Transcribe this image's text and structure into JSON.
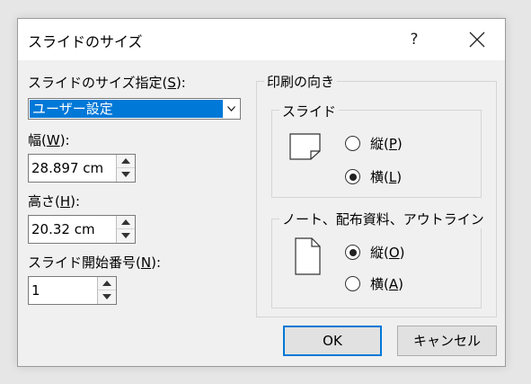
{
  "window": {
    "title": "スライドのサイズ",
    "help": "?"
  },
  "slide_size": {
    "label_prefix": "スライドのサイズ指定(",
    "label_key": "S",
    "label_suffix": "):",
    "selected": "ユーザー設定"
  },
  "width": {
    "label_prefix": "幅(",
    "label_key": "W",
    "label_suffix": "):",
    "value": "28.897 cm"
  },
  "height": {
    "label_prefix": "高さ(",
    "label_key": "H",
    "label_suffix": "):",
    "value": "20.32 cm"
  },
  "start_number": {
    "label_prefix": "スライド開始番号(",
    "label_key": "N",
    "label_suffix": "):",
    "value": "1"
  },
  "orientation": {
    "title": "印刷の向き",
    "slides": {
      "title": "スライド",
      "options": [
        {
          "label_prefix": "縦(",
          "key": "P",
          "label_suffix": ")",
          "selected": false
        },
        {
          "label_prefix": "横(",
          "key": "L",
          "label_suffix": ")",
          "selected": true
        }
      ]
    },
    "notes": {
      "title": "ノート、配布資料、アウトライン",
      "options": [
        {
          "label_prefix": "縦(",
          "key": "O",
          "label_suffix": ")",
          "selected": true
        },
        {
          "label_prefix": "横(",
          "key": "A",
          "label_suffix": ")",
          "selected": false
        }
      ]
    }
  },
  "buttons": {
    "ok": "OK",
    "cancel": "キャンセル"
  }
}
